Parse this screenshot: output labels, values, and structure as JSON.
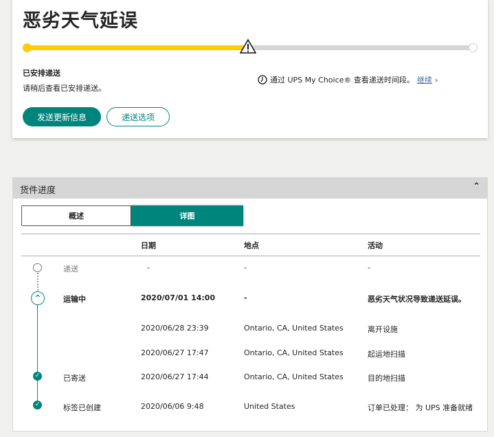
{
  "status": {
    "title": "恶劣天气延误",
    "progress_percent": 50,
    "colors": {
      "progress": "#ffcc00",
      "track": "#d6d6d6",
      "accent": "#00857d"
    },
    "scheduled_label": "已安排递送",
    "scheduled_sub": "请稍后查看已安排递送。",
    "mychoice_text": "通过 UPS My Choice® 查看递送时间段。",
    "mychoice_link": "继续",
    "send_updates_button": "发送更新信息",
    "delivery_options_button": "递送选项"
  },
  "progress_panel": {
    "title": "货件进度",
    "tabs": [
      {
        "label": "概述",
        "active": false
      },
      {
        "label": "详图",
        "active": true
      }
    ],
    "columns": [
      "日期",
      "地点",
      "活动"
    ],
    "rows": [
      {
        "status": "递送",
        "date": "-",
        "location": "-",
        "activity": "-",
        "marker": "empty-circle"
      },
      {
        "status": "运输中",
        "date": "2020/07/01  14:00",
        "location": "-",
        "activity": "恶劣天气状况导致递送延误。",
        "marker": "chevron-up-circle"
      },
      {
        "status": "",
        "date": "2020/06/28  23:39",
        "location": "Ontario, CA, United States",
        "activity": "离开设施",
        "marker": ""
      },
      {
        "status": "",
        "date": "2020/06/27  17:47",
        "location": "Ontario, CA, United States",
        "activity": "起运地扫描",
        "marker": ""
      },
      {
        "status": "已寄送",
        "date": "2020/06/27  17:44",
        "location": "Ontario, CA, United States",
        "activity": "目的地扫描",
        "marker": "check-circle"
      },
      {
        "status": "标签已创建",
        "date": "2020/06/06  9:48",
        "location": "United States",
        "activity": "订单已处理： 为 UPS 准备就绪",
        "marker": "check-circle"
      }
    ]
  }
}
